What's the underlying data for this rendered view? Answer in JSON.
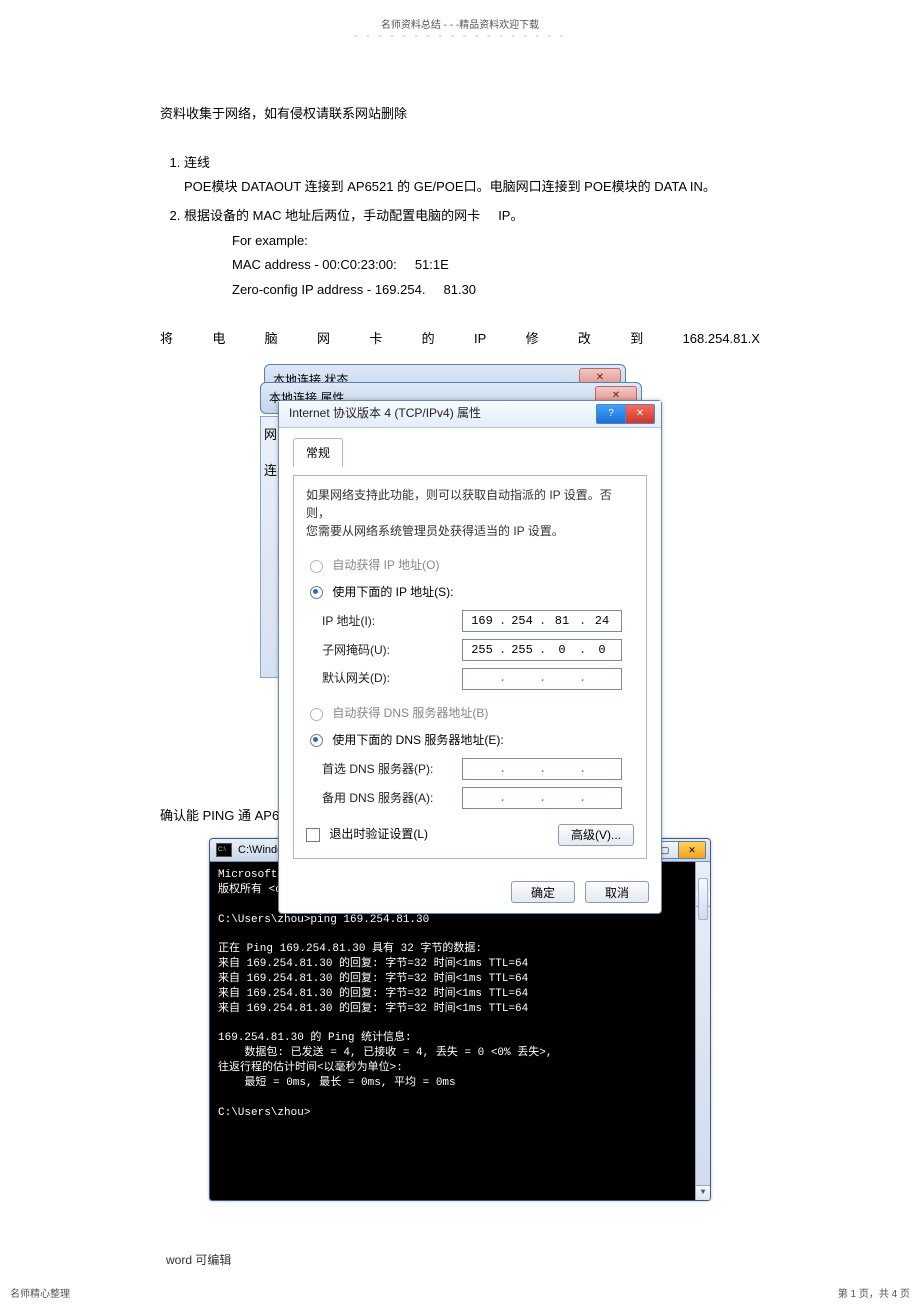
{
  "header": {
    "line": "名师资料总结 - - -精品资料欢迎下载",
    "dots": "- - - - - - - - - - - - - - - - - -"
  },
  "lead": "资料收集于网络，如有侵权请联系网站删除",
  "steps": {
    "s1_title": "连线",
    "s1_body": "POE模块  DATAOUT 连接到  AP6521 的 GE/POE口。电脑网口连接到  POE模块的 DATA IN。",
    "s2_body_a": "根据设备的  MAC 地址后两位，手动配置电脑的网卡",
    "s2_body_b": "IP。",
    "example_lbl": "For example:",
    "mac_line_a": "MAC address - 00:C0:23:00:",
    "mac_line_b": "51:1E",
    "zc_line_a": "Zero-config IP address - 169.254.",
    "zc_line_b": "81.30"
  },
  "spread": {
    "c0": "将",
    "c1": "电",
    "c2": "脑",
    "c3": "网",
    "c4": "卡",
    "c5": "的",
    "c6": "IP",
    "c7": "修",
    "c8": "改",
    "c9": "到",
    "target": "168.254.81.X"
  },
  "dialog": {
    "back1_title": "本地连接 状态",
    "back2_title": "本地连接 属性",
    "left_tab1": "网",
    "left_tab2": "连",
    "main_title": "Internet 协议版本 4 (TCP/IPv4) 属性",
    "tab_general": "常规",
    "desc": "如果网络支持此功能，则可以获取自动指派的 IP 设置。否则，\n您需要从网络系统管理员处获得适当的 IP 设置。",
    "r_auto_ip": "自动获得 IP 地址(O)",
    "r_manual_ip": "使用下面的 IP 地址(S):",
    "lbl_ip": "IP 地址(I):",
    "lbl_mask": "子网掩码(U):",
    "lbl_gw": "默认网关(D):",
    "ip": {
      "a": "169",
      "b": "254",
      "c": "81",
      "d": "24"
    },
    "mask": {
      "a": "255",
      "b": "255",
      "c": "0",
      "d": "0"
    },
    "gw": {
      "a": "",
      "b": "",
      "c": "",
      "d": ""
    },
    "r_auto_dns": "自动获得 DNS 服务器地址(B)",
    "r_manual_dns": "使用下面的 DNS 服务器地址(E):",
    "lbl_dns1": "首选 DNS 服务器(P):",
    "lbl_dns2": "备用 DNS 服务器(A):",
    "chk_validate": "退出时验证设置(L)",
    "btn_adv": "高级(V)...",
    "btn_ok": "确定",
    "btn_cancel": "取消",
    "help_icon": "?",
    "close_icon": "✕",
    "back_close": "✕"
  },
  "ping_confirm": "确认能 PING 通 AP6511",
  "cmd": {
    "title": "C:\\Windows\\system32\\cmd.exe",
    "min": "—",
    "max": "▢",
    "close": "✕",
    "up": "▲",
    "down": "▼",
    "l1": "Microsoft Windows [版本 6.1.7601]",
    "l2": "版权所有 <c> 2009 Microsoft Corporation。保留所有权利。",
    "l3": "",
    "l4": "C:\\Users\\zhou>ping 169.254.81.30",
    "l5": "",
    "l6": "正在 Ping 169.254.81.30 具有 32 字节的数据:",
    "l7": "来自 169.254.81.30 的回复: 字节=32 时间<1ms TTL=64",
    "l8": "来自 169.254.81.30 的回复: 字节=32 时间<1ms TTL=64",
    "l9": "来自 169.254.81.30 的回复: 字节=32 时间<1ms TTL=64",
    "l10": "来自 169.254.81.30 的回复: 字节=32 时间<1ms TTL=64",
    "l11": "",
    "l12": "169.254.81.30 的 Ping 统计信息:",
    "l13": "    数据包: 已发送 = 4, 已接收 = 4, 丢失 = 0 <0% 丢失>,",
    "l14": "往返行程的估计时间<以毫秒为单位>:",
    "l15": "    最短 = 0ms, 最长 = 0ms, 平均 = 0ms",
    "l16": "",
    "l17": "C:\\Users\\zhou>"
  },
  "footer_editable": "word 可编辑",
  "bottom_left": "名师精心整理",
  "bottom_right": "第 1 页，共 4 页"
}
